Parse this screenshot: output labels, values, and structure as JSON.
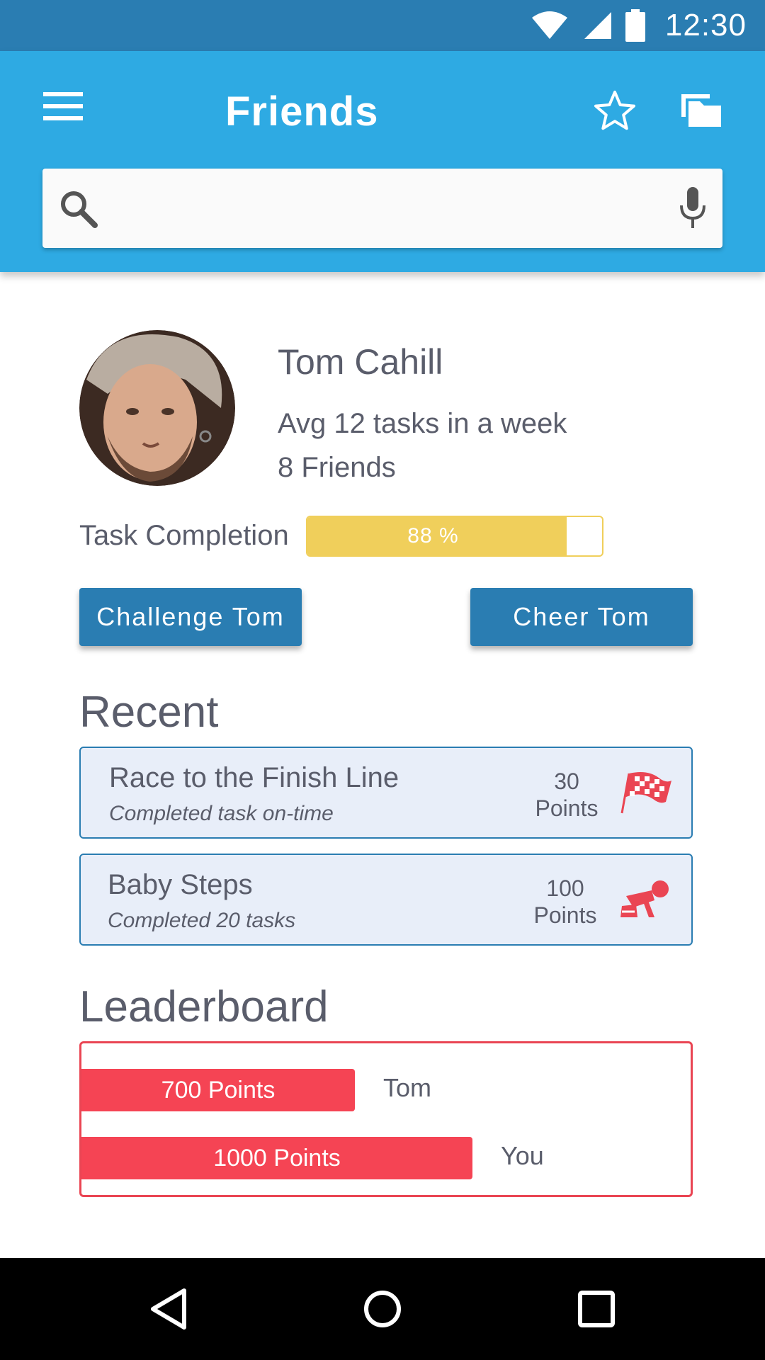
{
  "status_bar": {
    "time": "12:30"
  },
  "app_bar": {
    "title": "Friends"
  },
  "search": {
    "value": "",
    "placeholder": ""
  },
  "profile": {
    "name": "Tom Cahill",
    "avg_tasks": "Avg 12 tasks in a week",
    "friends": "8 Friends"
  },
  "task_completion": {
    "label": "Task Completion",
    "percent": 88,
    "text": "88 %"
  },
  "actions": {
    "challenge": "Challenge Tom",
    "cheer": "Cheer Tom"
  },
  "recent": {
    "title": "Recent",
    "items": [
      {
        "title": "Race to the Finish Line",
        "subtitle": "Completed task on-time",
        "points": "30",
        "points_label": "Points",
        "icon": "checkered-flag-icon"
      },
      {
        "title": "Baby Steps",
        "subtitle": "Completed 20 tasks",
        "points": "100",
        "points_label": "Points",
        "icon": "baby-crawling-icon"
      }
    ]
  },
  "leaderboard": {
    "title": "Leaderboard",
    "entries": [
      {
        "points_text": "700 Points",
        "points": 700,
        "name": "Tom"
      },
      {
        "points_text": "1000 Points",
        "points": 1000,
        "name": "You"
      }
    ]
  },
  "colors": {
    "status_bar": "#2a7db2",
    "app_bar": "#2eaae3",
    "button": "#2a7db2",
    "progress": "#f0cf5b",
    "accent_red": "#f54454"
  }
}
